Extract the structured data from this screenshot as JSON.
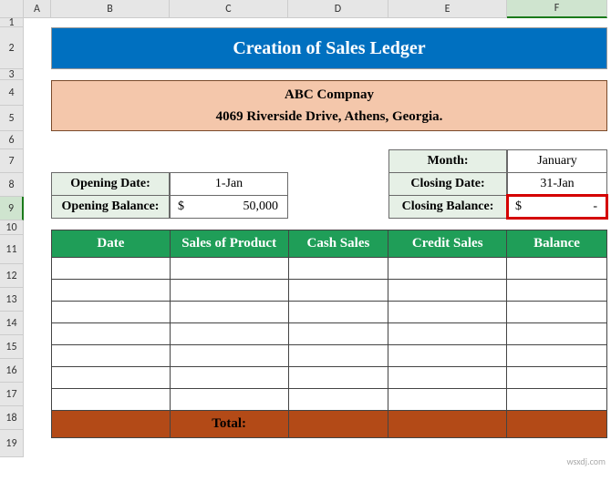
{
  "columns": [
    "A",
    "B",
    "C",
    "D",
    "E",
    "F"
  ],
  "rows": [
    "1",
    "2",
    "3",
    "4",
    "5",
    "6",
    "7",
    "8",
    "9",
    "10",
    "11",
    "12",
    "13",
    "14",
    "15",
    "16",
    "17",
    "18",
    "19"
  ],
  "selected_column": "F",
  "title": "Creation of Sales Ledger",
  "company": {
    "name": "ABC Compnay",
    "address": "4069 Riverside Drive, Athens, Georgia."
  },
  "opening": {
    "date_label": "Opening Date:",
    "date_value": "1-Jan",
    "balance_label": "Opening Balance:",
    "balance_currency": "$",
    "balance_value": "50,000"
  },
  "closing": {
    "month_label": "Month:",
    "month_value": "January",
    "date_label": "Closing Date:",
    "date_value": "31-Jan",
    "balance_label": "Closing Balance:",
    "balance_currency": "$",
    "balance_value": "-"
  },
  "ledger": {
    "headers": [
      "Date",
      "Sales of Product",
      "Cash Sales",
      "Credit Sales",
      "Balance"
    ],
    "blank_rows": 7,
    "total_label": "Total:"
  },
  "watermark": "wsxdj.com"
}
